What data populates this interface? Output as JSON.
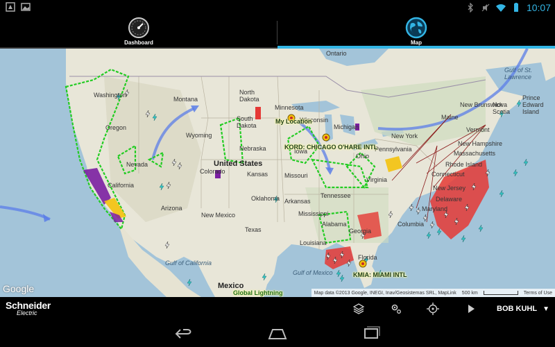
{
  "status_bar": {
    "time": "10:07",
    "icons": [
      "notification-icon",
      "image-icon",
      "bluetooth-icon",
      "mute-icon",
      "wifi-icon",
      "battery-icon"
    ]
  },
  "tabs": [
    {
      "label": "Dashboard",
      "icon": "gauge-icon",
      "selected": false
    },
    {
      "label": "Map",
      "icon": "globe-icon",
      "selected": true
    }
  ],
  "map": {
    "countries": {
      "us": "United States",
      "mexico": "Mexico"
    },
    "water": {
      "gulf_mexico": "Gulf of Mexico",
      "gulf_california": "Gulf of California",
      "gulf_st_lawrence_1": "Gulf of St.",
      "gulf_st_lawrence_2": "Lawrence"
    },
    "states": {
      "washington": "Washington",
      "oregon": "Oregon",
      "california": "California",
      "nevada": "Nevada",
      "arizona": "Arizona",
      "montana": "Montana",
      "wyoming": "Wyoming",
      "colorado": "Colorado",
      "new_mexico": "New Mexico",
      "north_dakota_1": "North",
      "north_dakota_2": "Dakota",
      "south_dakota_1": "South",
      "south_dakota_2": "Dakota",
      "nebraska": "Nebraska",
      "kansas": "Kansas",
      "oklahoma": "Oklahoma",
      "texas": "Texas",
      "minnesota": "Minnesota",
      "iowa": "Iowa",
      "missouri": "Missouri",
      "arkansas": "Arkansas",
      "louisiana": "Louisiana",
      "mississippi": "Mississippi",
      "alabama": "Alabama",
      "tennessee": "Tennessee",
      "georgia": "Georgia",
      "florida": "Florida",
      "wisconsin": "Wisconsin",
      "michigan": "Michigan",
      "ohio": "Ohio",
      "virginia": "Virginia",
      "pennsylvania": "Pennsylvania",
      "new_york": "New York",
      "maine": "Maine",
      "vermont": "Vermont",
      "new_hampshire": "New Hampshire",
      "massachusetts": "Massachusetts",
      "connecticut": "Connecticut",
      "rhode_island": "Rhode Island",
      "new_jersey": "New Jersey",
      "delaware": "Delaware",
      "maryland": "Maryland",
      "columbia": "Columbia",
      "ontario": "Ontario",
      "new_brunswick": "New Brunswick",
      "prince_edward_1": "Prince",
      "prince_edward_2": "Edward",
      "prince_edward_3": "Island",
      "nova_scotia_1": "Nova",
      "nova_scotia_2": "Scotia"
    },
    "airports": {
      "my_location": "My Location",
      "kord": "KORD: CHICAGO O'HARE INTL",
      "kmia": "KMIA: MIAMI INTL"
    },
    "global_label": "Global Lightning",
    "google_logo": "Google",
    "attribution": {
      "data": "Map data ©2013 Google, INEGI, Inav/Geosistemas SRL, MapLink",
      "scale": "500 km",
      "terms": "Terms of Use"
    },
    "colors": {
      "land": "#e8e6d8",
      "water": "#a3c4d9",
      "trace": "#22cc22",
      "jet": "#5b7ee8",
      "alert_red": "#e53935",
      "alert_purple": "#7b1fa2",
      "alert_yellow": "#f4c20d"
    }
  },
  "app_bar": {
    "brand_name": "Schneider",
    "brand_sub": "Electric",
    "actions": [
      "layers-icon",
      "settings-icon",
      "locate-icon",
      "play-icon"
    ],
    "user_name": "BOB KUHL"
  },
  "nav_bar": [
    "back-icon",
    "home-icon",
    "recents-icon"
  ]
}
